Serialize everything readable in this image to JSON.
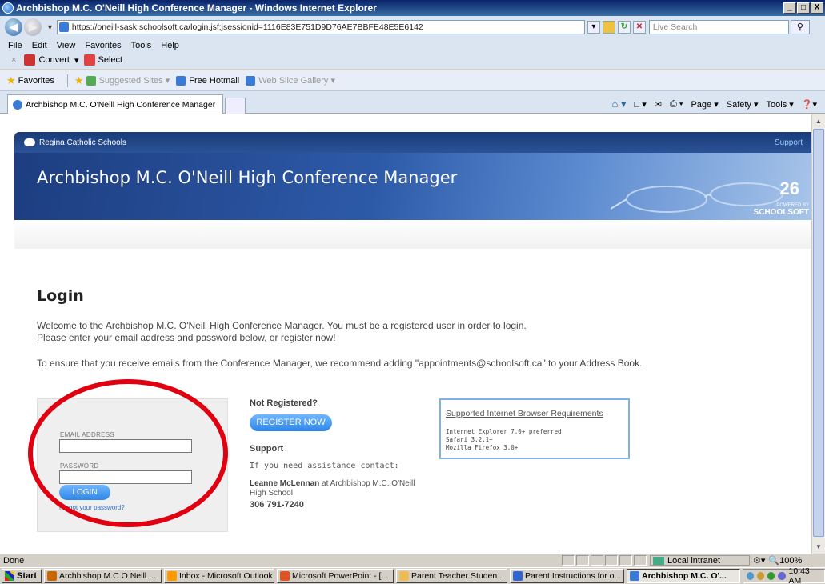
{
  "window": {
    "title": "Archbishop M.C. O'Neill High Conference Manager - Windows Internet Explorer",
    "controls": [
      "_",
      "□",
      "X"
    ]
  },
  "address_bar": {
    "url": "https://oneill-sask.schoolsoft.ca/login.jsf;jsessionid=1116E83E751D9D76AE7BBFE48E5E6142",
    "search_placeholder": "Live Search"
  },
  "menu": [
    "File",
    "Edit",
    "View",
    "Favorites",
    "Tools",
    "Help"
  ],
  "toolbar": {
    "convert": "Convert",
    "select": "Select"
  },
  "favorites": {
    "label": "Favorites",
    "items": [
      "Suggested Sites ▾",
      "Free Hotmail",
      "Web Slice Gallery ▾"
    ]
  },
  "tab": {
    "label": "Archbishop M.C. O'Neill High Conference Manager"
  },
  "commandbar": {
    "page": "Page ▾",
    "safety": "Safety ▾",
    "tools": "Tools ▾"
  },
  "site": {
    "org": "Regina Catholic Schools",
    "support_link": "Support",
    "banner_title": "Archbishop M.C. O'Neill High Conference Manager",
    "powered_by": "POWERED BY",
    "brand": "SCHOOLSOFT",
    "banner_number": "26"
  },
  "login": {
    "heading": "Login",
    "intro_line1": "Welcome to the Archbishop M.C. O'Neill High Conference Manager. You must be a registered user in order to login.",
    "intro_line2": "Please enter your email address and password below, or register now!",
    "intro_line3": "To ensure that you receive emails from the Conference Manager, we recommend adding \"appointments@schoolsoft.ca\" to your Address Book.",
    "email_label": "EMAIL ADDRESS",
    "password_label": "PASSWORD",
    "email_value": "",
    "password_value": "",
    "login_button": "LOGIN",
    "forgot_link": "Forgot your password?"
  },
  "register": {
    "heading": "Not Registered?",
    "button": "REGISTER NOW"
  },
  "support": {
    "heading": "Support",
    "text": "If you need assistance contact:",
    "contact_name": "Leanne McLennan",
    "contact_rest": " at Archbishop M.C. O'Neill High School",
    "phone": "306 791-7240"
  },
  "requirements": {
    "title": "Supported Internet Browser Requirements",
    "lines": [
      "Internet Explorer 7.0+ preferred",
      "Safari 3.2.1+",
      "Mozilla Firefox 3.0+"
    ]
  },
  "statusbar": {
    "status": "Done",
    "zone": "Local intranet",
    "zoom": "🔍100%"
  },
  "taskbar": {
    "start": "Start",
    "items": [
      "Archbishop M.C.O Neill ...",
      "Inbox - Microsoft Outlook",
      "Microsoft PowerPoint - [...",
      "Parent Teacher Studen...",
      "Parent Instructions for o...",
      "Archbishop M.C. O'..."
    ],
    "clock": "10:43 AM"
  }
}
